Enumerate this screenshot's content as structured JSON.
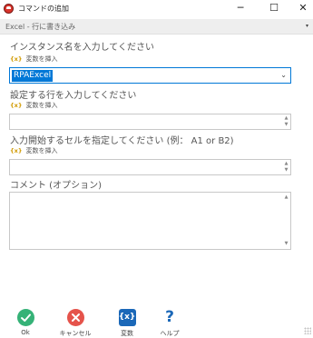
{
  "window": {
    "title": "コマンドの追加",
    "controls": {
      "minimize": "─",
      "maximize": "☐",
      "close": "✕"
    }
  },
  "command_selector": {
    "value": "Excel - 行に書き込み",
    "arrow": "▾"
  },
  "fields": {
    "instance": {
      "label": "インスタンス名を入力してください",
      "insert_var": "変数を挿入",
      "value": "RPAExcel",
      "dropdown_arrow": "⌄"
    },
    "row": {
      "label": "設定する行を入力してください",
      "insert_var": "変数を挿入",
      "value": ""
    },
    "start_cell": {
      "label": "入力開始するセルを指定してください (例： A1 or B2)",
      "insert_var": "変数を挿入",
      "value": ""
    },
    "comment": {
      "label": "コメント (オプション)",
      "value": ""
    }
  },
  "var_icon_text": "{x}",
  "toolbar": {
    "ok_label": "Ok",
    "cancel_label": "キャンセル",
    "variable_label": "変数",
    "variable_icon": "{x}",
    "help_label": "ヘルプ",
    "help_icon": "?"
  },
  "colors": {
    "ok": "#35b277",
    "cancel": "#e5534b",
    "variable": "#1b68b8",
    "selection": "#0078d7",
    "var_icon": "#d19a00"
  }
}
